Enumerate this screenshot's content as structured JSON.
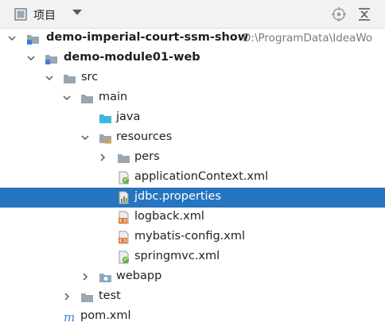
{
  "header": {
    "title": "项目",
    "icons": {
      "project": "project-view-icon",
      "dropdown": "chevron-down-icon",
      "locate": "locate-crosshair-icon",
      "collapse": "collapse-all-icon"
    }
  },
  "tree": {
    "rows": [
      {
        "label": "demo-imperial-court-ssm-show",
        "path": "D:\\ProgramData\\IdeaWo",
        "expanded": true,
        "icon": "module-folder-icon"
      },
      {
        "label": "demo-module01-web",
        "expanded": true,
        "icon": "module-folder-icon"
      },
      {
        "label": "src",
        "expanded": true,
        "icon": "folder-icon"
      },
      {
        "label": "main",
        "expanded": true,
        "icon": "folder-icon"
      },
      {
        "label": "java",
        "icon": "source-root-folder-icon"
      },
      {
        "label": "resources",
        "expanded": true,
        "icon": "resources-folder-icon"
      },
      {
        "label": "pers",
        "expanded": false,
        "icon": "folder-icon"
      },
      {
        "label": "applicationContext.xml",
        "icon": "spring-xml-icon"
      },
      {
        "label": "jdbc.properties",
        "icon": "properties-file-icon",
        "selected": true
      },
      {
        "label": "logback.xml",
        "icon": "xml-file-icon"
      },
      {
        "label": "mybatis-config.xml",
        "icon": "xml-file-icon"
      },
      {
        "label": "springmvc.xml",
        "icon": "spring-xml-icon"
      },
      {
        "label": "webapp",
        "expanded": false,
        "icon": "web-folder-icon"
      },
      {
        "label": "test",
        "expanded": false,
        "icon": "folder-icon"
      },
      {
        "label": "pom.xml",
        "icon": "maven-icon"
      }
    ]
  },
  "colors": {
    "selection": "#2675bf",
    "folder": "#9aa7b0",
    "java_folder": "#40b6e0",
    "xml_badge": "#e57e3b",
    "spring_badge": "#62b543",
    "maven": "#3b7fd4"
  }
}
